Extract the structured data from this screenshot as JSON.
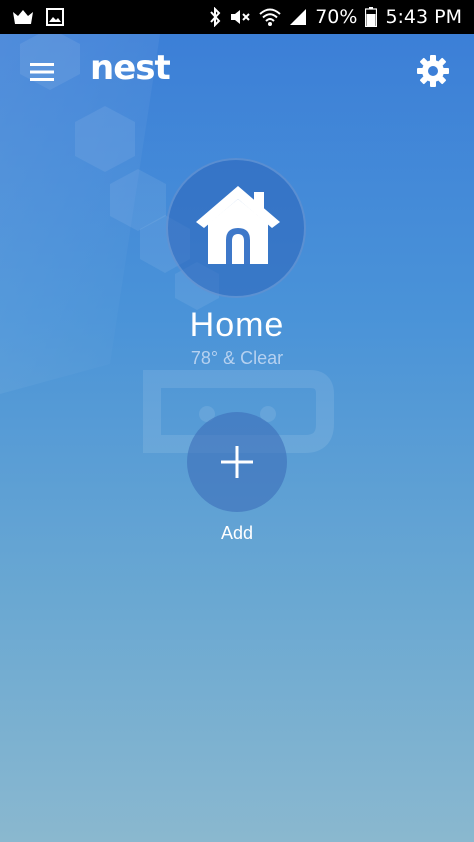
{
  "status_bar": {
    "battery": "70%",
    "time": "5:43 PM"
  },
  "app": {
    "logo": "nest"
  },
  "home": {
    "name": "Home",
    "weather": "78° & Clear"
  },
  "add": {
    "label": "Add"
  }
}
